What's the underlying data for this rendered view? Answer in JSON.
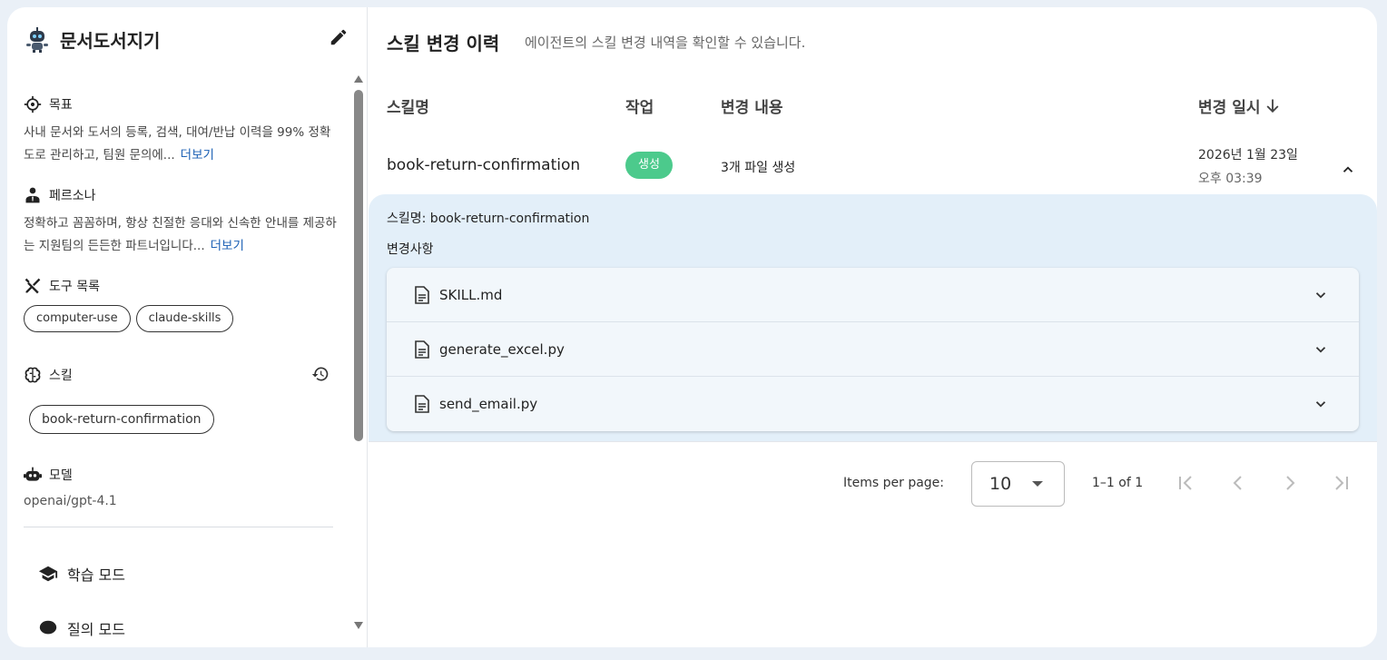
{
  "sidebar": {
    "agent_name": "문서도서지기",
    "goal": {
      "title": "목표",
      "text": "사내 문서와 도서의 등록, 검색, 대여/반납 이력을 99% 정확도로 관리하고, 팀원 문의에...",
      "more": "더보기"
    },
    "persona": {
      "title": "페르소나",
      "text": "정확하고 꼼꼼하며, 항상 친절한 응대와 신속한 안내를 제공하는 지원팀의 든든한 파트너입니다...",
      "more": "더보기"
    },
    "tools": {
      "title": "도구 목록",
      "items": [
        "computer-use",
        "claude-skills"
      ]
    },
    "skills": {
      "title": "스킬",
      "items": [
        "book-return-confirmation"
      ]
    },
    "model": {
      "title": "모델",
      "value": "openai/gpt-4.1"
    },
    "modes": [
      "학습 모드",
      "질의 모드"
    ]
  },
  "main": {
    "title": "스킬 변경 이력",
    "subtitle": "에이전트의 스킬 변경 내역을 확인할 수 있습니다.",
    "columns": {
      "skill": "스킬명",
      "action": "작업",
      "change": "변경 내용",
      "date": "변경 일시"
    },
    "rows": [
      {
        "skill": "book-return-confirmation",
        "action": "생성",
        "change": "3개 파일 생성",
        "date": "2026년 1월 23일",
        "time": "오후 03:39",
        "detail": {
          "skill_line": "스킬명: book-return-confirmation",
          "changes_label": "변경사항",
          "files": [
            "SKILL.md",
            "generate_excel.py",
            "send_email.py"
          ]
        }
      }
    ],
    "pagination": {
      "items_per_page_label": "Items per page:",
      "items_per_page": "10",
      "range": "1–1 of 1"
    }
  },
  "colors": {
    "badge_create": "#4cca8c",
    "detail_bg": "#e3eff9",
    "link": "#1a5fb4"
  }
}
